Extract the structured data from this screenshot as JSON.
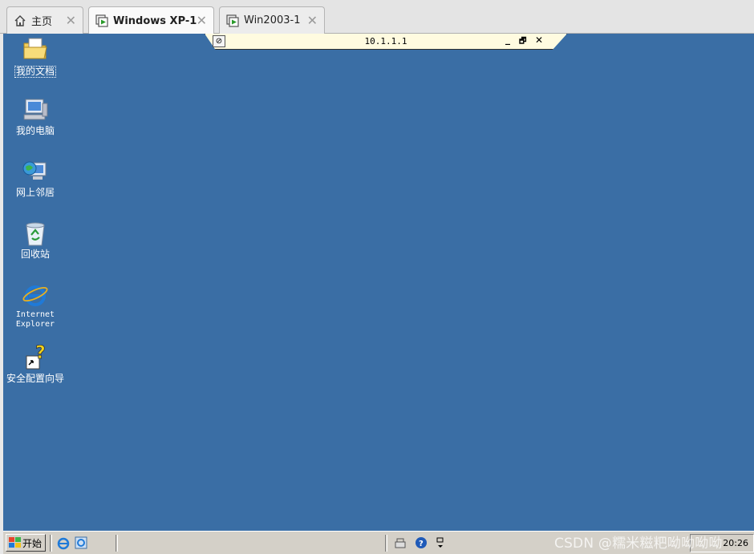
{
  "tabs": [
    {
      "label": "主页",
      "icon": "home-icon",
      "active": false
    },
    {
      "label": "Windows XP-1",
      "icon": "vm-icon",
      "active": true
    },
    {
      "label": "Win2003-1",
      "icon": "vm-icon",
      "active": false
    }
  ],
  "close_glyph": "✕",
  "remote_bar": {
    "title": "10.1.1.1",
    "pin_glyph": "⊘",
    "minimize": "_",
    "restore": "🗗",
    "close": "✕"
  },
  "desktop": {
    "background": "#3a6ea5",
    "icons": [
      {
        "label": "我的文档",
        "icon": "my-documents-icon"
      },
      {
        "label": "我的电脑",
        "icon": "my-computer-icon"
      },
      {
        "label": "网上邻居",
        "icon": "network-places-icon"
      },
      {
        "label": "回收站",
        "icon": "recycle-bin-icon"
      },
      {
        "label": "Internet\nExplorer",
        "label_line1": "Internet",
        "label_line2": "Explorer",
        "icon": "internet-explorer-icon"
      },
      {
        "label": "安全配置向导",
        "icon": "security-wizard-icon"
      }
    ]
  },
  "taskbar": {
    "start_label": "开始",
    "clock": "20:26"
  },
  "watermark": "CSDN @糯米糍粑呦呦呦呦"
}
